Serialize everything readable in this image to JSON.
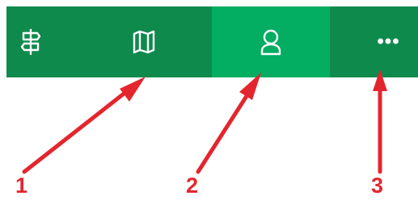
{
  "toolbar": {
    "background": "#0f8a4d",
    "active_background": "#03ad61",
    "tabs": [
      {
        "name": "signpost",
        "icon": "signpost-icon",
        "active": false
      },
      {
        "name": "map",
        "icon": "map-icon",
        "active": false
      },
      {
        "name": "profile",
        "icon": "person-icon",
        "active": true
      },
      {
        "name": "more",
        "icon": "more-horizontal-icon",
        "active": false,
        "glyph": "•••"
      }
    ]
  },
  "annotations": {
    "color": "#e3262e",
    "labels": [
      "1",
      "2",
      "3"
    ]
  }
}
